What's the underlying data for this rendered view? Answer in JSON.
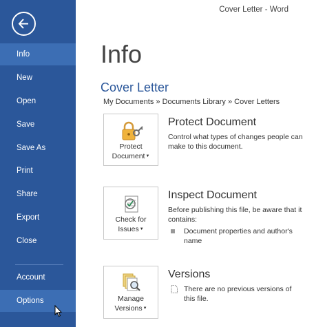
{
  "window": {
    "title": "Cover Letter - Word"
  },
  "sidebar": {
    "items": [
      {
        "label": "Info"
      },
      {
        "label": "New"
      },
      {
        "label": "Open"
      },
      {
        "label": "Save"
      },
      {
        "label": "Save As"
      },
      {
        "label": "Print"
      },
      {
        "label": "Share"
      },
      {
        "label": "Export"
      },
      {
        "label": "Close"
      },
      {
        "label": "Account"
      },
      {
        "label": "Options"
      }
    ],
    "selected": "Info",
    "hovered": "Options"
  },
  "main": {
    "page_title": "Info",
    "document_name": "Cover Letter",
    "breadcrumb": "My Documents » Documents Library » Cover Letters",
    "protect": {
      "tile_line1": "Protect",
      "tile_line2": "Document",
      "title": "Protect Document",
      "description": "Control what types of changes people can make to this document."
    },
    "inspect": {
      "tile_line1": "Check for",
      "tile_line2": "Issues",
      "title": "Inspect Document",
      "description": "Before publishing this file, be aware that it contains:",
      "bullets": [
        "Document properties and author's name"
      ]
    },
    "versions": {
      "tile_line1": "Manage",
      "tile_line2": "Versions",
      "title": "Versions",
      "description": "There are no previous versions of this file."
    }
  },
  "colors": {
    "sidebar_bg": "#2b579a",
    "sidebar_selected": "#3c6eb4",
    "accent": "#2b579a"
  },
  "icons": [
    "back-arrow-icon",
    "lock-key-icon",
    "check-document-icon",
    "versions-magnifier-icon",
    "document-icon",
    "mouse-cursor-icon"
  ]
}
